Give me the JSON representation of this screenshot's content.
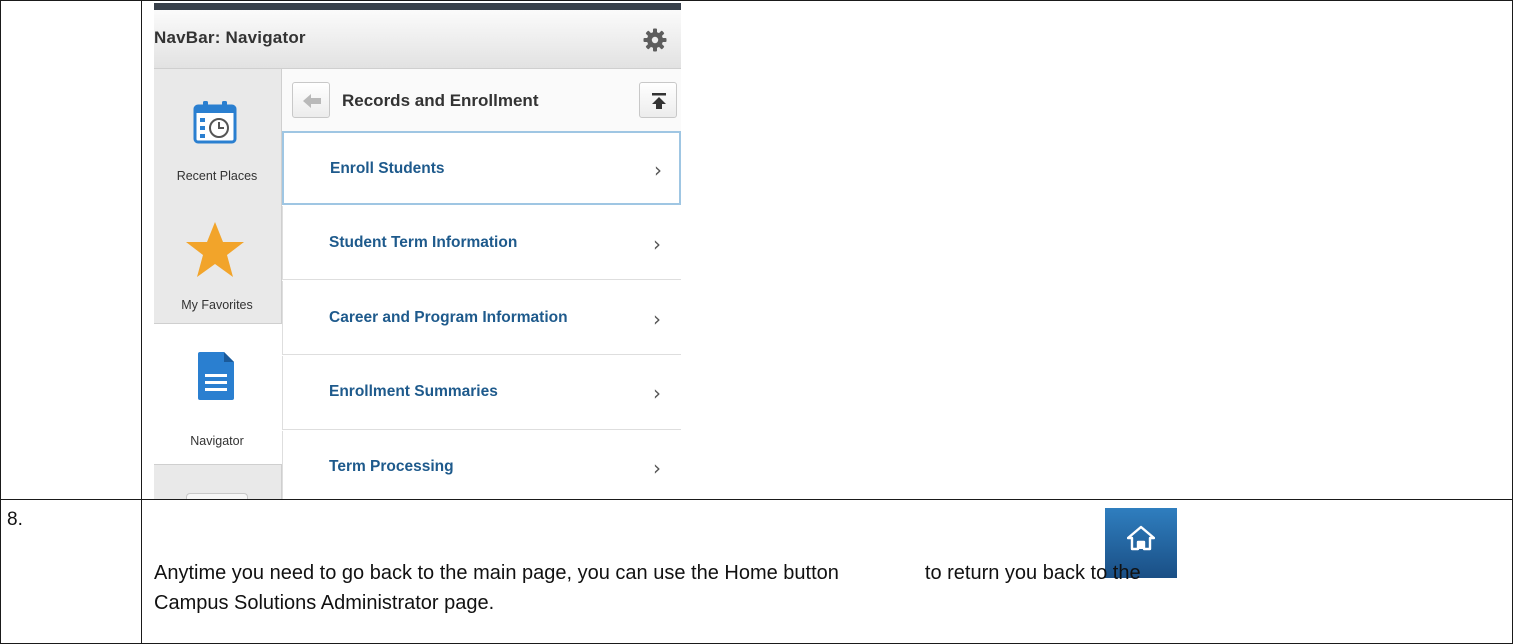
{
  "step8": {
    "number": "8.",
    "text_before": "Anytime you need to go back to the main page, you can use the Home button",
    "text_after": "to return you back to the",
    "text_line2": "Campus Solutions Administrator page."
  },
  "navbar": {
    "title": "NavBar: Navigator",
    "sidebar": [
      {
        "label": "Recent Places",
        "icon": "calendar-clock-icon"
      },
      {
        "label": "My Favorites",
        "icon": "star-icon"
      },
      {
        "label": "Navigator",
        "icon": "document-icon"
      }
    ],
    "panel_title": "Records and Enrollment",
    "items": [
      {
        "label": "Enroll Students"
      },
      {
        "label": "Student Term Information"
      },
      {
        "label": "Career and Program Information"
      },
      {
        "label": "Enrollment Summaries"
      },
      {
        "label": "Term Processing"
      }
    ]
  },
  "colors": {
    "link": "#1e5a8c",
    "star": "#f2a42a",
    "icon_blue": "#2a7fd0",
    "home_button": "#1f5f9e"
  }
}
